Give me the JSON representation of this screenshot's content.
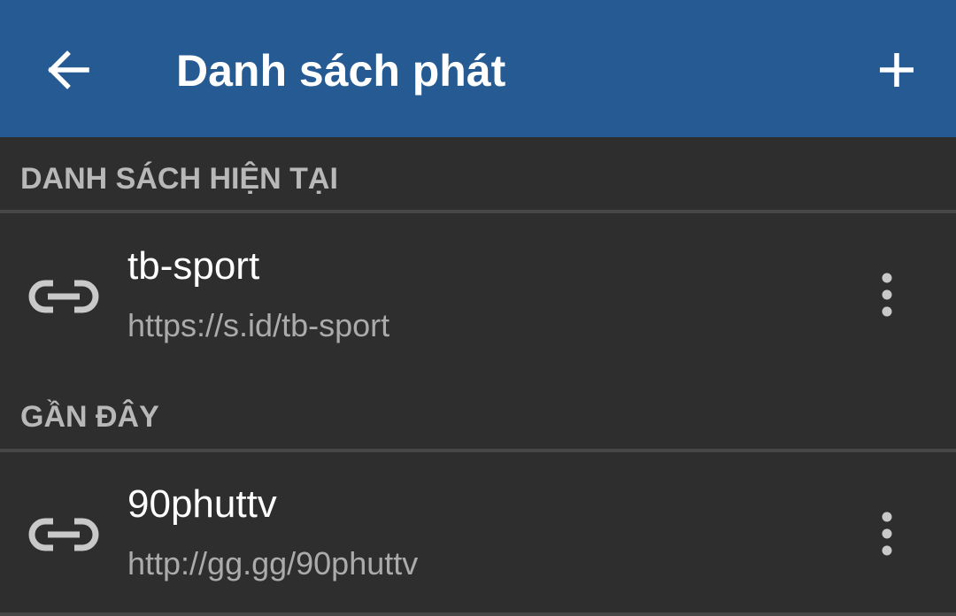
{
  "appbar": {
    "title": "Danh sách phát",
    "back_icon": "arrow-left-icon",
    "add_icon": "plus-icon",
    "color": "#255a92"
  },
  "sections": [
    {
      "header": "DANH SÁCH HIỆN TẠI",
      "items": [
        {
          "title": "tb-sport",
          "url": "https://s.id/tb-sport",
          "icon": "link-icon",
          "menu_icon": "more-vert-icon"
        }
      ]
    },
    {
      "header": "GẦN ĐÂY",
      "items": [
        {
          "title": "90phuttv",
          "url": "http://gg.gg/90phuttv",
          "icon": "link-icon",
          "menu_icon": "more-vert-icon"
        }
      ]
    }
  ]
}
